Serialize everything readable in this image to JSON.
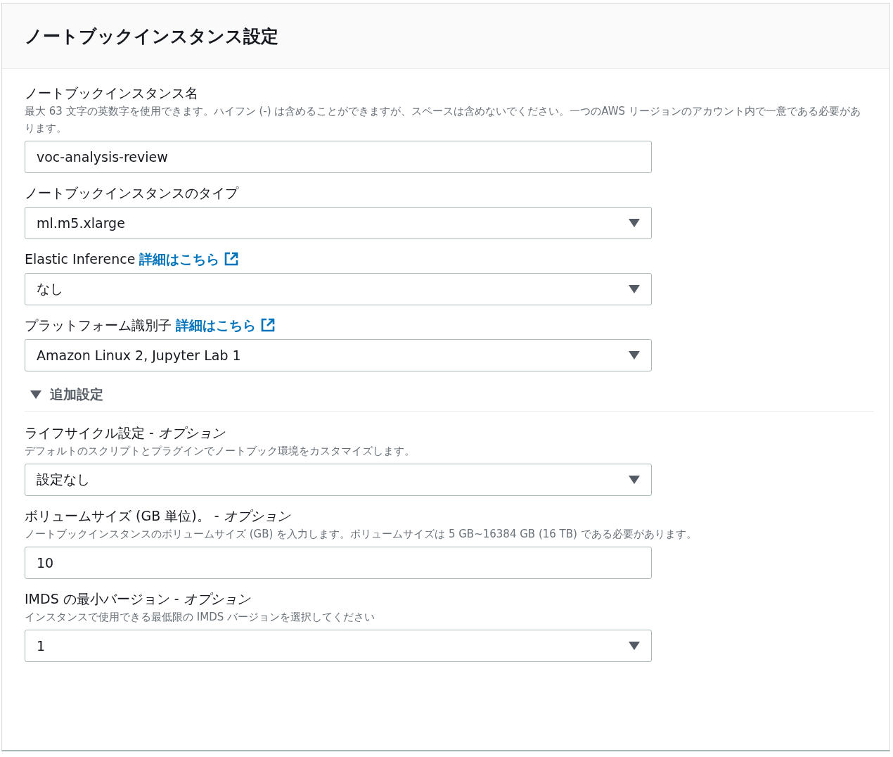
{
  "panel": {
    "title": "ノートブックインスタンス設定"
  },
  "fields": [
    {
      "kind": "input",
      "label": "ノートブックインスタンス名",
      "value": "voc-analysis-review",
      "description": "最大 63 文字の英数字を使用できます。ハイフン (-) は含めることができますが、スペースは含めないでください。一つのAWS リージョンのアカウント内で一意である必要があります。"
    },
    {
      "kind": "select",
      "label": "ノートブックインスタンスのタイプ",
      "value": "ml.m5.xlarge"
    },
    {
      "kind": "select",
      "label": "Elastic Inference",
      "link": "詳細はこちら",
      "value": "なし"
    },
    {
      "kind": "select",
      "label": "プラットフォーム識別子",
      "link": "詳細はこちら",
      "value": "Amazon Linux 2, Jupyter Lab 1"
    }
  ],
  "additional": {
    "title": "追加設定",
    "expanded": true,
    "fields": [
      {
        "kind": "select",
        "label": "ライフサイクル設定 - *オプション*",
        "description": "デフォルトのスクリプトとプラグインでノートブック環境をカスタマイズします。",
        "value": "設定なし"
      },
      {
        "kind": "input",
        "label": "ボリュームサイズ (GB 単位)。 - *オプション*",
        "description": "ノートブックインスタンスのボリュームサイズ (GB) を入力します。ボリュームサイズは 5 GB~16384 GB (16 TB) である必要があります。",
        "value": "10"
      },
      {
        "kind": "select",
        "label": "IMDS の最小バージョン - *オプション*",
        "description": "インスタンスで使用できる最低限の IMDS バージョンを選択してください",
        "value": "1"
      }
    ]
  }
}
